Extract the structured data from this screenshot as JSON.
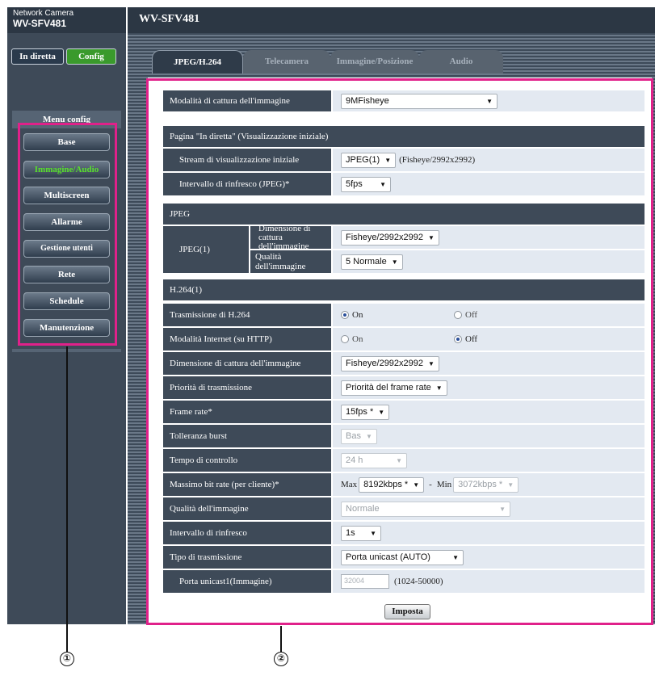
{
  "app": {
    "product_line1": "Network Camera",
    "product_line2": "WV-SFV481",
    "header_title": "WV-SFV481"
  },
  "modes": {
    "live": "In diretta",
    "config": "Config"
  },
  "menu": {
    "title": "Menu config",
    "items": [
      {
        "label": "Base",
        "active": false
      },
      {
        "label": "Immagine/Audio",
        "active": true
      },
      {
        "label": "Multiscreen",
        "active": false
      },
      {
        "label": "Allarme",
        "active": false
      },
      {
        "label": "Gestione utenti",
        "active": false
      },
      {
        "label": "Rete",
        "active": false
      },
      {
        "label": "Schedule",
        "active": false
      },
      {
        "label": "Manutenzione",
        "active": false
      }
    ]
  },
  "tabs": [
    "JPEG/H.264",
    "Telecamera",
    "Immagine/Posizione",
    "Audio"
  ],
  "form": {
    "capture_mode": {
      "label": "Modalità di cattura dell'immagine",
      "value": "9MFisheye"
    },
    "live_page": {
      "section": "Pagina \"In diretta\" (Visualizzazione iniziale)",
      "stream_label": "Stream di visualizzazione iniziale",
      "stream_value": "JPEG(1)",
      "stream_note": "(Fisheye/2992x2992)",
      "refresh_label": "Intervallo di rinfresco (JPEG)*",
      "refresh_value": "5fps"
    },
    "jpeg": {
      "section": "JPEG",
      "group_label": "JPEG(1)",
      "size_label_l1": "Dimensione di",
      "size_label_l2": "cattura dell'immagine",
      "size_value": "Fisheye/2992x2992",
      "quality_label": "Qualità dell'immagine",
      "quality_value": "5 Normale"
    },
    "h264": {
      "section": "H.264(1)",
      "transmission": {
        "label": "Trasmissione di H.264",
        "on": "On",
        "off": "Off",
        "selected": "On"
      },
      "internet_mode": {
        "label": "Modalità Internet (su HTTP)",
        "on": "On",
        "off": "Off",
        "selected": "Off"
      },
      "capture_size": {
        "label": "Dimensione di cattura dell'immagine",
        "value": "Fisheye/2992x2992"
      },
      "priority": {
        "label": "Priorità di trasmissione",
        "value": "Priorità del frame rate"
      },
      "frame_rate": {
        "label": "Frame rate*",
        "value": "15fps *"
      },
      "burst": {
        "label": "Tolleranza burst",
        "value": "Bas"
      },
      "control_time": {
        "label": "Tempo di controllo",
        "value": "24 h"
      },
      "bitrate": {
        "label": "Massimo bit rate (per cliente)*",
        "max_label": "Max",
        "max_value": "8192kbps *",
        "dash": "-",
        "min_label": "Min",
        "min_value": "3072kbps *"
      },
      "quality": {
        "label": "Qualità dell'immagine",
        "value": "Normale"
      },
      "refresh": {
        "label": "Intervallo di rinfresco",
        "value": "1s"
      },
      "transmission_type": {
        "label": "Tipo di trasmissione",
        "value": "Porta unicast (AUTO)"
      },
      "unicast_port": {
        "label": "Porta unicast1(Immagine)",
        "value": "32004",
        "range": "(1024-50000)"
      }
    },
    "save_label": "Imposta"
  },
  "annotations": {
    "callout1": "①",
    "callout2": "②",
    "highlight_color": "#e0218a"
  }
}
